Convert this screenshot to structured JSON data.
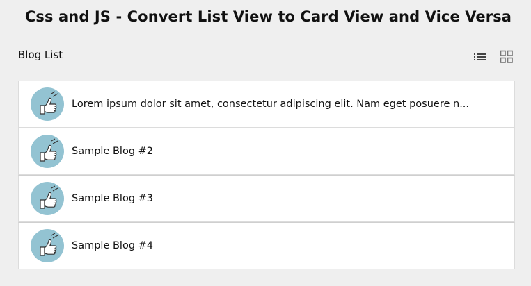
{
  "page": {
    "title": "Css and JS - Convert List View to Card View and Vice Versa"
  },
  "list": {
    "header": "Blog List",
    "view_toggles": [
      {
        "icon": "list-view-icon",
        "active": true
      },
      {
        "icon": "card-view-icon",
        "active": false
      }
    ],
    "items": [
      {
        "title": "Lorem ipsum dolor sit amet, consectetur adipiscing elit. Nam eget posuere n...",
        "icon": "thumbs-up-icon"
      },
      {
        "title": "Sample Blog #2",
        "icon": "thumbs-up-icon"
      },
      {
        "title": "Sample Blog #3",
        "icon": "thumbs-up-icon"
      },
      {
        "title": "Sample Blog #4",
        "icon": "thumbs-up-icon"
      }
    ]
  },
  "colors": {
    "background": "#efefef",
    "card": "#ffffff",
    "thumb_circle": "#93c3d2"
  }
}
